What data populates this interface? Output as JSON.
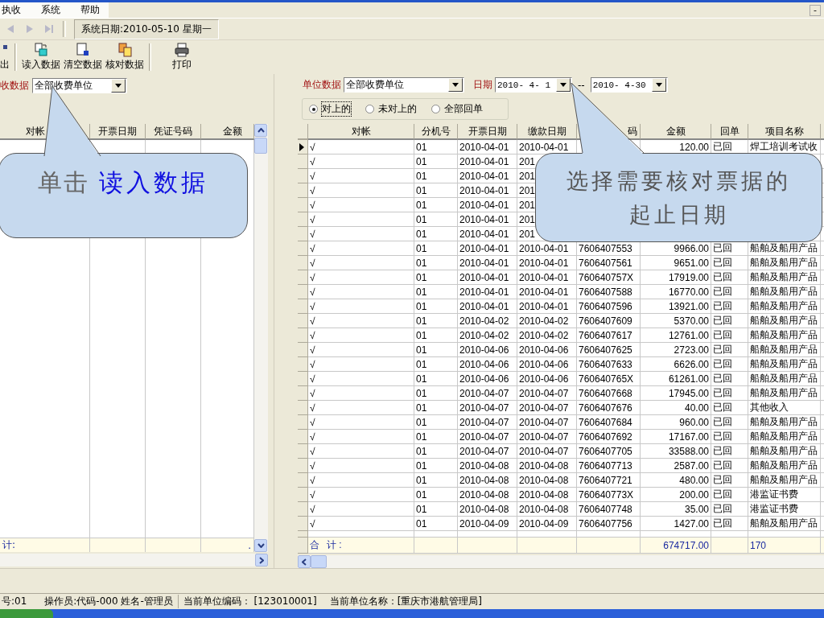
{
  "menu": {
    "items": [
      "执收",
      "系统",
      "帮助"
    ],
    "minimize": "-"
  },
  "nav": {
    "buttons": [
      {
        "kind": "previous",
        "disabled": true
      },
      {
        "kind": "next",
        "disabled": true
      },
      {
        "kind": "last",
        "disabled": true
      }
    ],
    "system_date": "系统日期:2010-05-10 星期一"
  },
  "toolbar": [
    {
      "label": "出",
      "kind": "exit"
    },
    {
      "label": "读入数据",
      "kind": "read"
    },
    {
      "label": "清空数据",
      "kind": "clear"
    },
    {
      "label": "核对数据",
      "kind": "check"
    },
    {
      "label": "打印",
      "kind": "print"
    }
  ],
  "left_panel": {
    "filter_label": "收数据",
    "unit_combo": "全部收费单位",
    "columns": [
      "对帐",
      "开票日期",
      "凭证号码",
      "金额"
    ],
    "total_label": "计:",
    "total_amount": "."
  },
  "right_panel": {
    "unit_label": "单位数据",
    "unit_combo": "全部收费单位",
    "date_label": "日期",
    "date_from": "2010- 4- 1",
    "date_separator": "--",
    "date_to": "2010- 4-30",
    "filter_options": [
      {
        "label": "对上的",
        "selected": true
      },
      {
        "label": "未对上的",
        "selected": false
      },
      {
        "label": "全部回单",
        "selected": false
      }
    ],
    "columns": [
      "对帐",
      "分机号",
      "开票日期",
      "缴款日期",
      "码",
      "金额",
      "回单",
      "项目名称"
    ],
    "rows": [
      {
        "selected": true,
        "check": "√",
        "branch": "01",
        "invoice_date": "2010-04-01",
        "payment_date": "2010-04-01",
        "amount": "120.00",
        "receipt": "已回",
        "item": "焊工培训考试收"
      },
      {
        "selected": false,
        "check": "√",
        "branch": "01",
        "invoice_date": "2010-04-01",
        "payment_date": "201"
      },
      {
        "selected": false,
        "check": "√",
        "branch": "01",
        "invoice_date": "2010-04-01",
        "payment_date": "201"
      },
      {
        "selected": false,
        "check": "√",
        "branch": "01",
        "invoice_date": "2010-04-01",
        "payment_date": "201"
      },
      {
        "selected": false,
        "check": "√",
        "branch": "01",
        "invoice_date": "2010-04-01",
        "payment_date": "201"
      },
      {
        "selected": false,
        "check": "√",
        "branch": "01",
        "invoice_date": "2010-04-01",
        "payment_date": "201"
      },
      {
        "selected": false,
        "check": "√",
        "branch": "01",
        "invoice_date": "2010-04-01",
        "payment_date": "201"
      },
      {
        "selected": false,
        "check": "√",
        "branch": "01",
        "invoice_date": "2010-04-01",
        "payment_date": "2010-04-01",
        "voucher": "7606407553",
        "amount": "9966.00",
        "receipt": "已回",
        "item": "船舶及船用产品"
      },
      {
        "selected": false,
        "check": "√",
        "branch": "01",
        "invoice_date": "2010-04-01",
        "payment_date": "2010-04-01",
        "voucher": "7606407561",
        "amount": "9651.00",
        "receipt": "已回",
        "item": "船舶及船用产品"
      },
      {
        "selected": false,
        "check": "√",
        "branch": "01",
        "invoice_date": "2010-04-01",
        "payment_date": "2010-04-01",
        "voucher": "760640757X",
        "amount": "17919.00",
        "receipt": "已回",
        "item": "船舶及船用产品"
      },
      {
        "selected": false,
        "check": "√",
        "branch": "01",
        "invoice_date": "2010-04-01",
        "payment_date": "2010-04-01",
        "voucher": "7606407588",
        "amount": "16770.00",
        "receipt": "已回",
        "item": "船舶及船用产品"
      },
      {
        "selected": false,
        "check": "√",
        "branch": "01",
        "invoice_date": "2010-04-01",
        "payment_date": "2010-04-01",
        "voucher": "7606407596",
        "amount": "13921.00",
        "receipt": "已回",
        "item": "船舶及船用产品"
      },
      {
        "selected": false,
        "check": "√",
        "branch": "01",
        "invoice_date": "2010-04-02",
        "payment_date": "2010-04-02",
        "voucher": "7606407609",
        "amount": "5370.00",
        "receipt": "已回",
        "item": "船舶及船用产品"
      },
      {
        "selected": false,
        "check": "√",
        "branch": "01",
        "invoice_date": "2010-04-02",
        "payment_date": "2010-04-02",
        "voucher": "7606407617",
        "amount": "12761.00",
        "receipt": "已回",
        "item": "船舶及船用产品"
      },
      {
        "selected": false,
        "check": "√",
        "branch": "01",
        "invoice_date": "2010-04-06",
        "payment_date": "2010-04-06",
        "voucher": "7606407625",
        "amount": "2723.00",
        "receipt": "已回",
        "item": "船舶及船用产品"
      },
      {
        "selected": false,
        "check": "√",
        "branch": "01",
        "invoice_date": "2010-04-06",
        "payment_date": "2010-04-06",
        "voucher": "7606407633",
        "amount": "6626.00",
        "receipt": "已回",
        "item": "船舶及船用产品"
      },
      {
        "selected": false,
        "check": "√",
        "branch": "01",
        "invoice_date": "2010-04-06",
        "payment_date": "2010-04-06",
        "voucher": "760640765X",
        "amount": "61261.00",
        "receipt": "已回",
        "item": "船舶及船用产品"
      },
      {
        "selected": false,
        "check": "√",
        "branch": "01",
        "invoice_date": "2010-04-07",
        "payment_date": "2010-04-07",
        "voucher": "7606407668",
        "amount": "17945.00",
        "receipt": "已回",
        "item": "船舶及船用产品"
      },
      {
        "selected": false,
        "check": "√",
        "branch": "01",
        "invoice_date": "2010-04-07",
        "payment_date": "2010-04-07",
        "voucher": "7606407676",
        "amount": "40.00",
        "receipt": "已回",
        "item": "其他收入"
      },
      {
        "selected": false,
        "check": "√",
        "branch": "01",
        "invoice_date": "2010-04-07",
        "payment_date": "2010-04-07",
        "voucher": "7606407684",
        "amount": "960.00",
        "receipt": "已回",
        "item": "船舶及船用产品"
      },
      {
        "selected": false,
        "check": "√",
        "branch": "01",
        "invoice_date": "2010-04-07",
        "payment_date": "2010-04-07",
        "voucher": "7606407692",
        "amount": "17167.00",
        "receipt": "已回",
        "item": "船舶及船用产品"
      },
      {
        "selected": false,
        "check": "√",
        "branch": "01",
        "invoice_date": "2010-04-07",
        "payment_date": "2010-04-07",
        "voucher": "7606407705",
        "amount": "33588.00",
        "receipt": "已回",
        "item": "船舶及船用产品"
      },
      {
        "selected": false,
        "check": "√",
        "branch": "01",
        "invoice_date": "2010-04-08",
        "payment_date": "2010-04-08",
        "voucher": "7606407713",
        "amount": "2587.00",
        "receipt": "已回",
        "item": "船舶及船用产品"
      },
      {
        "selected": false,
        "check": "√",
        "branch": "01",
        "invoice_date": "2010-04-08",
        "payment_date": "2010-04-08",
        "voucher": "7606407721",
        "amount": "480.00",
        "receipt": "已回",
        "item": "船舶及船用产品"
      },
      {
        "selected": false,
        "check": "√",
        "branch": "01",
        "invoice_date": "2010-04-08",
        "payment_date": "2010-04-08",
        "voucher": "760640773X",
        "amount": "200.00",
        "receipt": "已回",
        "item": "港监证书费"
      },
      {
        "selected": false,
        "check": "√",
        "branch": "01",
        "invoice_date": "2010-04-08",
        "payment_date": "2010-04-08",
        "voucher": "7606407748",
        "amount": "35.00",
        "receipt": "已回",
        "item": "港监证书费"
      },
      {
        "selected": false,
        "check": "√",
        "branch": "01",
        "invoice_date": "2010-04-09",
        "payment_date": "2010-04-09",
        "voucher": "7606407756",
        "amount": "1427.00",
        "receipt": "已回",
        "item": "船舶及船用产品"
      }
    ],
    "total": {
      "label": "合 计:",
      "amount": "674717.00",
      "count": "170"
    }
  },
  "status_bar": [
    "号:01",
    "操作员:代码-000 姓名-管理员",
    "当前单位编码： [123010001]",
    "当前单位名称：[重庆市港航管理局]"
  ],
  "callouts": [
    {
      "lead": "单击",
      "highlight": "读入数据"
    },
    {
      "lines": [
        "选择需要核对票据的",
        "起止日期"
      ]
    }
  ]
}
